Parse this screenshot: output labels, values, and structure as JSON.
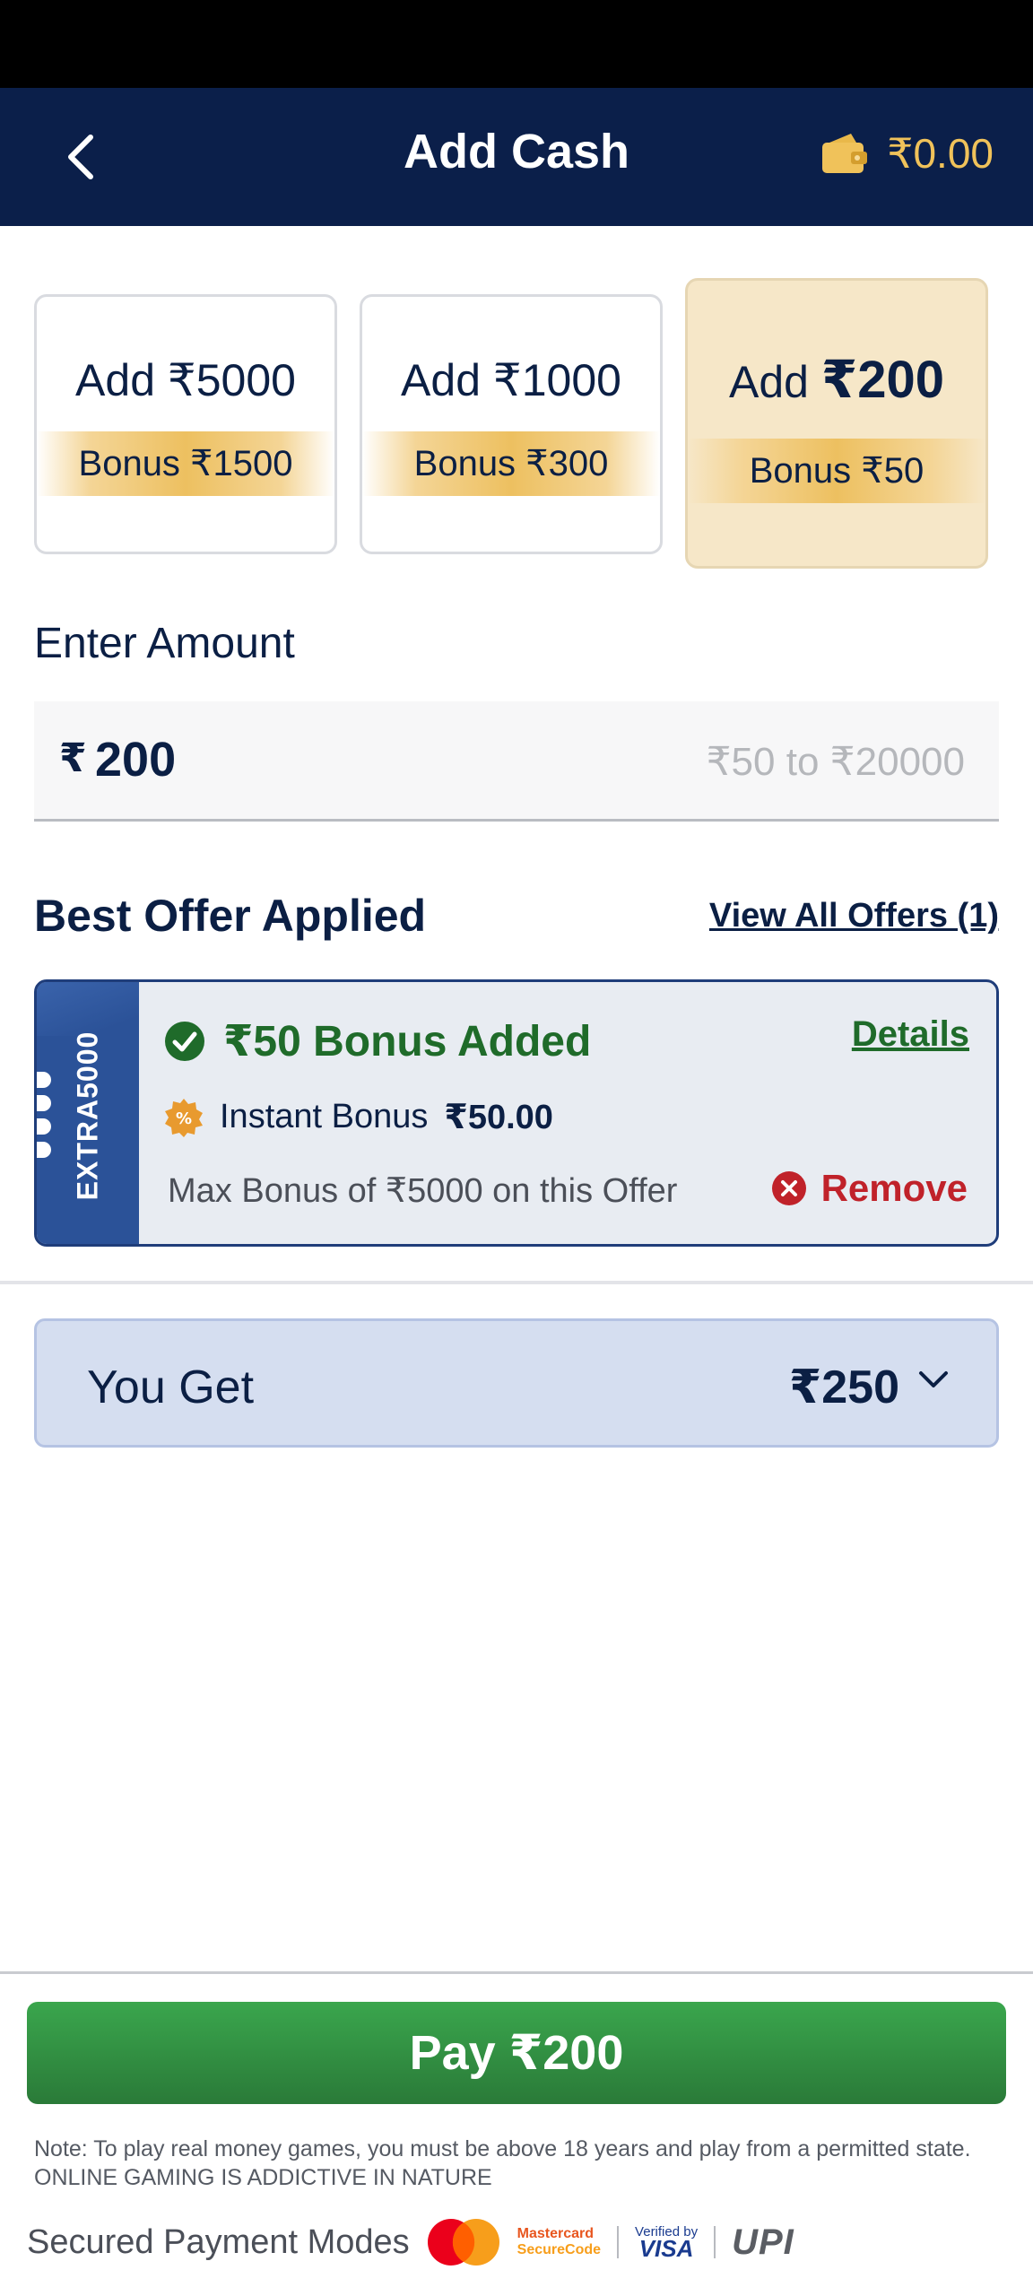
{
  "header": {
    "title": "Add Cash",
    "wallet_balance": "₹0.00"
  },
  "amount_cards": [
    {
      "add_prefix": "Add ",
      "amount": "₹5000",
      "bonus": "Bonus ₹1500",
      "selected": false
    },
    {
      "add_prefix": "Add ",
      "amount": "₹1000",
      "bonus": "Bonus ₹300",
      "selected": false
    },
    {
      "add_prefix": "Add ",
      "amount": "₹200",
      "bonus": "Bonus ₹50",
      "selected": true
    }
  ],
  "enter_amount": {
    "label": "Enter Amount",
    "currency": "₹",
    "value": "200",
    "range": "₹50 to ₹20000"
  },
  "offer": {
    "heading": "Best Offer Applied",
    "view_all": "View All Offers (1)",
    "code": "EXTRA5000",
    "bonus_added": "₹50 Bonus Added",
    "details": "Details",
    "instant_label": "Instant Bonus",
    "instant_value": "₹50.00",
    "max_bonus": "Max Bonus of ₹5000 on this Offer",
    "remove": "Remove"
  },
  "you_get": {
    "label": "You Get",
    "value": "₹250"
  },
  "pay_button": "Pay ₹200",
  "note": {
    "line1": "Note: To play real money games, you must be above 18 years and play from a permitted state.",
    "line2": "ONLINE GAMING IS ADDICTIVE IN NATURE"
  },
  "payment_modes": {
    "label": "Secured Payment Modes",
    "mastercard_line1": "Mastercard",
    "mastercard_line2": "SecureCode",
    "visa_line1": "Verified by",
    "visa_line2": "VISA",
    "upi": "UPI"
  },
  "colors": {
    "header_bg": "#0b1f4a",
    "wallet_gold": "#f0c25a",
    "selected_card": "#f6e7c8",
    "success_green": "#1f6b2a",
    "remove_red": "#c0222a",
    "pay_green": "#2f8e41"
  }
}
